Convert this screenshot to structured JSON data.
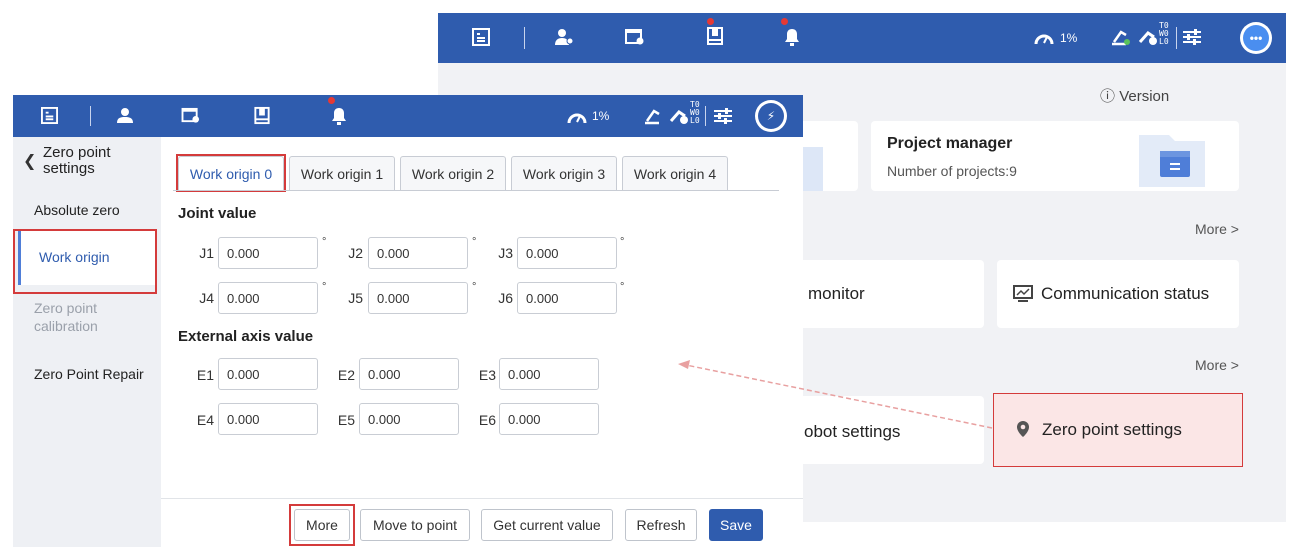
{
  "colors": {
    "topbar": "#2f5cae",
    "accent": "#4f7ed8",
    "highlight": "#d43b3b",
    "alert": "#e53935"
  },
  "back_window": {
    "topbar": {
      "speed": "1%",
      "coord_top": "T0",
      "coord_mid": "W0",
      "coord_bot": "L0"
    },
    "version_label": "Version",
    "project_manager": {
      "title": "Project manager",
      "subtitle": "Number of projects:9"
    },
    "more_1": "More >",
    "monitor_label": "monitor",
    "communication_status": "Communication status",
    "more_2": "More >",
    "robot_settings": "obot settings",
    "zero_point_settings": "Zero point settings"
  },
  "front_window": {
    "topbar": {
      "speed": "1%",
      "coord_top": "T0",
      "coord_mid": "W0",
      "coord_bot": "L0"
    },
    "sidebar": {
      "title_line1": "Zero point",
      "title_line2": "settings",
      "items": [
        {
          "label": "Absolute zero"
        },
        {
          "label": "Work origin"
        },
        {
          "label_line1": "Zero point",
          "label_line2": "calibration"
        },
        {
          "label": "Zero Point Repair"
        }
      ]
    },
    "tabs": [
      "Work origin 0",
      "Work origin 1",
      "Work origin 2",
      "Work origin 3",
      "Work origin 4"
    ],
    "joint_section": "Joint value",
    "joints": [
      {
        "label": "J1",
        "value": "0.000",
        "unit": "°"
      },
      {
        "label": "J2",
        "value": "0.000",
        "unit": "°"
      },
      {
        "label": "J3",
        "value": "0.000",
        "unit": "°"
      },
      {
        "label": "J4",
        "value": "0.000",
        "unit": "°"
      },
      {
        "label": "J5",
        "value": "0.000",
        "unit": "°"
      },
      {
        "label": "J6",
        "value": "0.000",
        "unit": "°"
      }
    ],
    "external_section": "External axis value",
    "external": [
      {
        "label": "E1",
        "value": "0.000"
      },
      {
        "label": "E2",
        "value": "0.000"
      },
      {
        "label": "E3",
        "value": "0.000"
      },
      {
        "label": "E4",
        "value": "0.000"
      },
      {
        "label": "E5",
        "value": "0.000"
      },
      {
        "label": "E6",
        "value": "0.000"
      }
    ],
    "buttons": {
      "more": "More",
      "move_to_point": "Move to point",
      "get_current_value": "Get current value",
      "refresh": "Refresh",
      "save": "Save"
    }
  }
}
